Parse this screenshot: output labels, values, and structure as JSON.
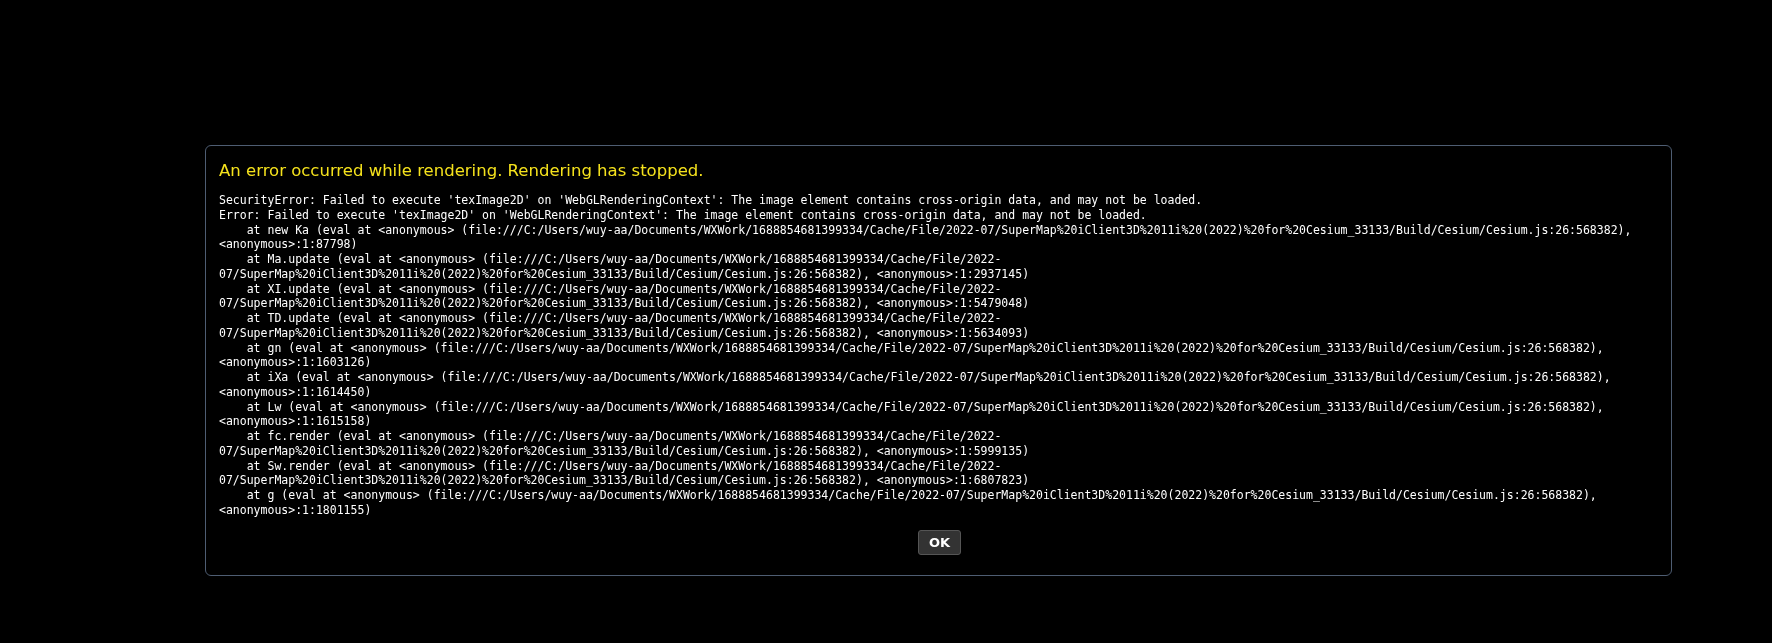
{
  "dialog": {
    "title": "An error occurred while rendering. Rendering has stopped.",
    "message_lines": [
      "SecurityError: Failed to execute 'texImage2D' on 'WebGLRenderingContext': The image element contains cross-origin data, and may not be loaded.",
      "Error: Failed to execute 'texImage2D' on 'WebGLRenderingContext': The image element contains cross-origin data, and may not be loaded.",
      "    at new Ka (eval at <anonymous> (file:///C:/Users/wuy-aa/Documents/WXWork/1688854681399334/Cache/File/2022-07/SuperMap%20iClient3D%2011i%20(2022)%20for%20Cesium_33133/Build/Cesium/Cesium.js:26:568382),",
      "<anonymous>:1:87798)",
      "    at Ma.update (eval at <anonymous> (file:///C:/Users/wuy-aa/Documents/WXWork/1688854681399334/Cache/File/2022-",
      "07/SuperMap%20iClient3D%2011i%20(2022)%20for%20Cesium_33133/Build/Cesium/Cesium.js:26:568382), <anonymous>:1:2937145)",
      "    at XI.update (eval at <anonymous> (file:///C:/Users/wuy-aa/Documents/WXWork/1688854681399334/Cache/File/2022-",
      "07/SuperMap%20iClient3D%2011i%20(2022)%20for%20Cesium_33133/Build/Cesium/Cesium.js:26:568382), <anonymous>:1:5479048)",
      "    at TD.update (eval at <anonymous> (file:///C:/Users/wuy-aa/Documents/WXWork/1688854681399334/Cache/File/2022-",
      "07/SuperMap%20iClient3D%2011i%20(2022)%20for%20Cesium_33133/Build/Cesium/Cesium.js:26:568382), <anonymous>:1:5634093)",
      "    at gn (eval at <anonymous> (file:///C:/Users/wuy-aa/Documents/WXWork/1688854681399334/Cache/File/2022-07/SuperMap%20iClient3D%2011i%20(2022)%20for%20Cesium_33133/Build/Cesium/Cesium.js:26:568382),",
      "<anonymous>:1:1603126)",
      "    at iXa (eval at <anonymous> (file:///C:/Users/wuy-aa/Documents/WXWork/1688854681399334/Cache/File/2022-07/SuperMap%20iClient3D%2011i%20(2022)%20for%20Cesium_33133/Build/Cesium/Cesium.js:26:568382),",
      "<anonymous>:1:1614450)",
      "    at Lw (eval at <anonymous> (file:///C:/Users/wuy-aa/Documents/WXWork/1688854681399334/Cache/File/2022-07/SuperMap%20iClient3D%2011i%20(2022)%20for%20Cesium_33133/Build/Cesium/Cesium.js:26:568382),",
      "<anonymous>:1:1615158)",
      "    at fc.render (eval at <anonymous> (file:///C:/Users/wuy-aa/Documents/WXWork/1688854681399334/Cache/File/2022-",
      "07/SuperMap%20iClient3D%2011i%20(2022)%20for%20Cesium_33133/Build/Cesium/Cesium.js:26:568382), <anonymous>:1:5999135)",
      "    at Sw.render (eval at <anonymous> (file:///C:/Users/wuy-aa/Documents/WXWork/1688854681399334/Cache/File/2022-",
      "07/SuperMap%20iClient3D%2011i%20(2022)%20for%20Cesium_33133/Build/Cesium/Cesium.js:26:568382), <anonymous>:1:6807823)",
      "    at g (eval at <anonymous> (file:///C:/Users/wuy-aa/Documents/WXWork/1688854681399334/Cache/File/2022-07/SuperMap%20iClient3D%2011i%20(2022)%20for%20Cesium_33133/Build/Cesium/Cesium.js:26:568382),",
      "<anonymous>:1:1801155)"
    ],
    "button": "OK"
  }
}
